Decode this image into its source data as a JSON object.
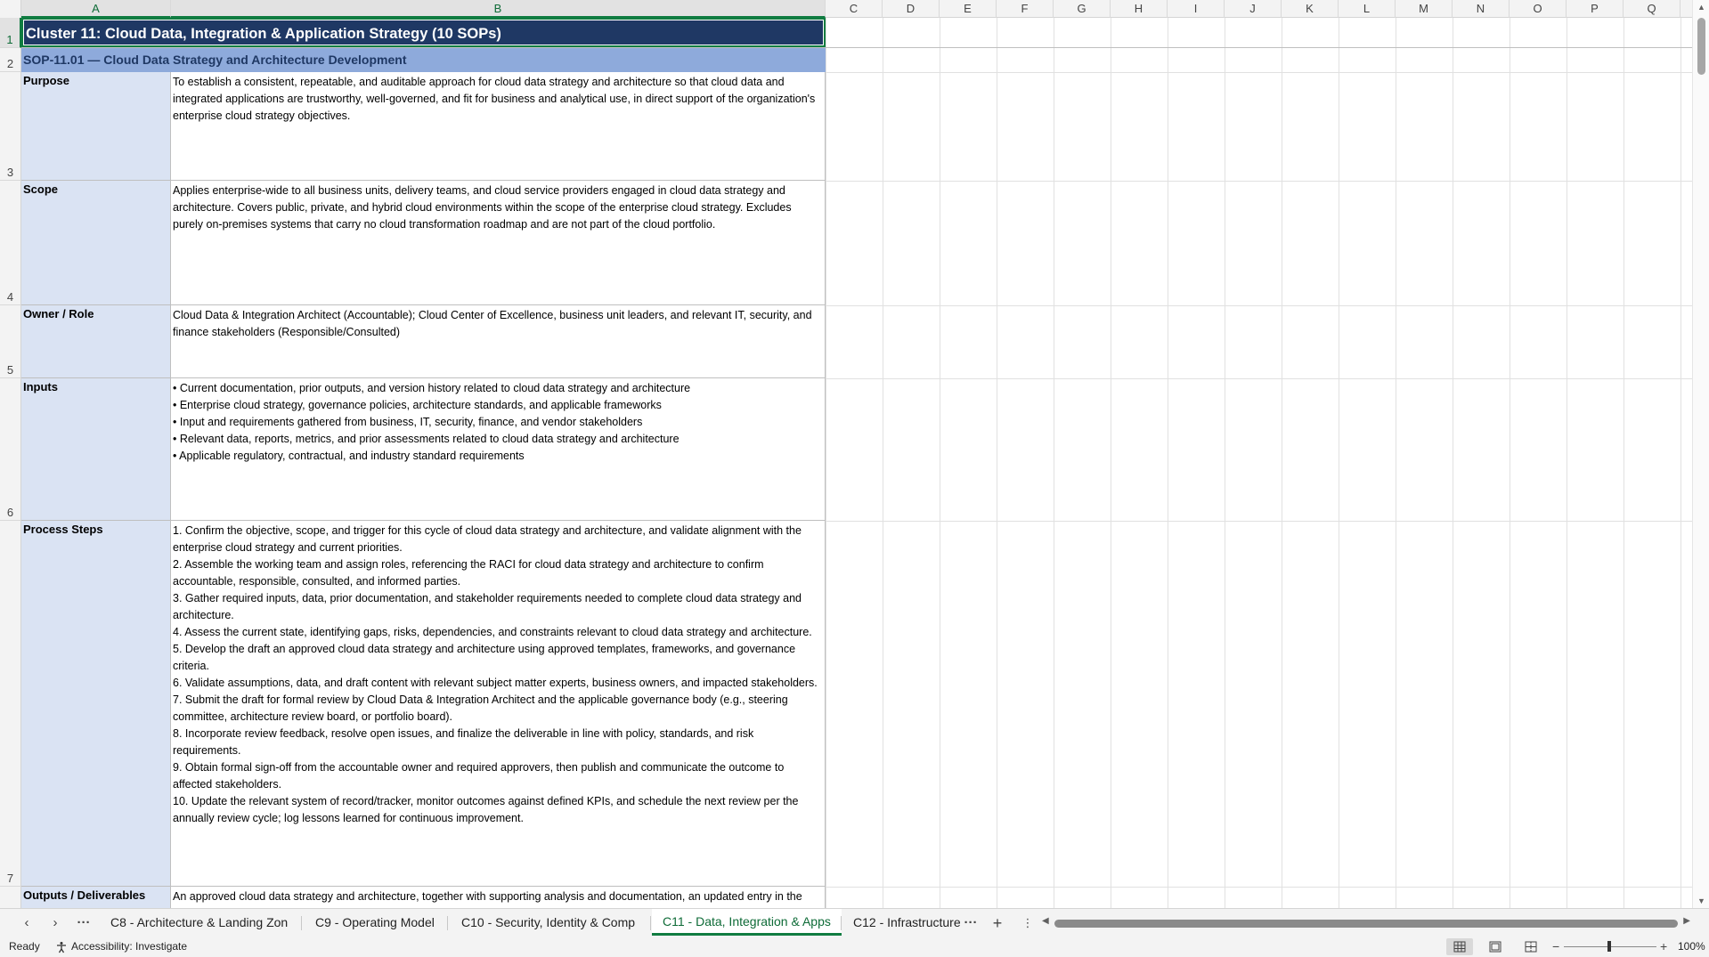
{
  "columns": {
    "headers": [
      "A",
      "B",
      "C",
      "D",
      "E",
      "F",
      "G",
      "H",
      "I",
      "J",
      "K",
      "L",
      "M",
      "N",
      "O",
      "P",
      "Q"
    ]
  },
  "rows": {
    "numbers": [
      "1",
      "2",
      "3",
      "4",
      "5",
      "6",
      "7"
    ]
  },
  "sheet": {
    "title": "Cluster 11: Cloud Data, Integration & Application Strategy  (10 SOPs)",
    "sop_header": "SOP-11.01  —  Cloud Data Strategy and Architecture Development",
    "sections": [
      {
        "label": "Purpose",
        "text": "To establish a consistent, repeatable, and auditable approach for cloud data strategy and architecture so that cloud data and integrated applications are trustworthy, well-governed, and fit for business and analytical use, in direct support of the organization's enterprise cloud strategy objectives."
      },
      {
        "label": "Scope",
        "text": "Applies enterprise-wide to all business units, delivery teams, and cloud service providers engaged in cloud data strategy and architecture. Covers public, private, and hybrid cloud environments within the scope of the enterprise cloud strategy. Excludes purely on-premises systems that carry no cloud transformation roadmap and are not part of the cloud portfolio."
      },
      {
        "label": "Owner / Role",
        "text": "Cloud Data & Integration Architect (Accountable); Cloud Center of Excellence, business unit leaders, and relevant IT, security, and finance stakeholders (Responsible/Consulted)"
      },
      {
        "label": "Inputs",
        "text": "• Current documentation, prior outputs, and version history related to cloud data strategy and architecture\n• Enterprise cloud strategy, governance policies, architecture standards, and applicable frameworks\n• Input and requirements gathered from business, IT, security, finance, and vendor stakeholders\n• Relevant data, reports, metrics, and prior assessments related to cloud data strategy and architecture\n• Applicable regulatory, contractual, and industry standard requirements"
      },
      {
        "label": "Process Steps",
        "text": "1. Confirm the objective, scope, and trigger for this cycle of cloud data strategy and architecture, and validate alignment with the enterprise cloud strategy and current priorities.\n2. Assemble the working team and assign roles, referencing the RACI for cloud data strategy and architecture to confirm accountable, responsible, consulted, and informed parties.\n3. Gather required inputs, data, prior documentation, and stakeholder requirements needed to complete cloud data strategy and architecture.\n4. Assess the current state, identifying gaps, risks, dependencies, and constraints relevant to cloud data strategy and architecture.\n5. Develop the draft an approved cloud data strategy and architecture using approved templates, frameworks, and governance criteria.\n6. Validate assumptions, data, and draft content with relevant subject matter experts, business owners, and impacted stakeholders.\n7. Submit the draft for formal review by Cloud Data & Integration Architect and the applicable governance body (e.g., steering committee, architecture review board, or portfolio board).\n8. Incorporate review feedback, resolve open issues, and finalize the deliverable in line with policy, standards, and risk requirements.\n9. Obtain formal sign-off from the accountable owner and required approvers, then publish and communicate the outcome to affected stakeholders.\n10. Update the relevant system of record/tracker, monitor outcomes against defined KPIs, and schedule the next review per the annually review cycle; log lessons learned for continuous improvement."
      },
      {
        "label": "Outputs / Deliverables",
        "text": "An approved cloud data strategy and architecture, together with supporting analysis and documentation, an updated entry in the"
      }
    ]
  },
  "tabs": {
    "items": [
      "C8 - Architecture & Landing Zon",
      "C9 - Operating Model",
      "C10 - Security, Identity & Comp",
      "C11 - Data, Integration & Apps",
      "C12 - Infrastructure"
    ],
    "active_index": 3
  },
  "status": {
    "ready": "Ready",
    "accessibility": "Accessibility: Investigate",
    "zoom": "100%"
  },
  "icons": {
    "prev_sheet": "chevron-left-icon",
    "next_sheet": "chevron-right-icon",
    "more_sheets": "ellipsis-icon",
    "add_sheet": "plus-icon",
    "tab_options": "vertical-ellipsis-icon",
    "accessibility": "accessibility-icon",
    "normal_view": "grid-view-icon",
    "page_layout": "page-layout-icon",
    "page_break": "page-break-icon"
  },
  "colors": {
    "title_bg": "#1f3864",
    "sop_bg": "#8eaadb",
    "label_bg": "#dae3f3",
    "accent": "#107c41"
  }
}
